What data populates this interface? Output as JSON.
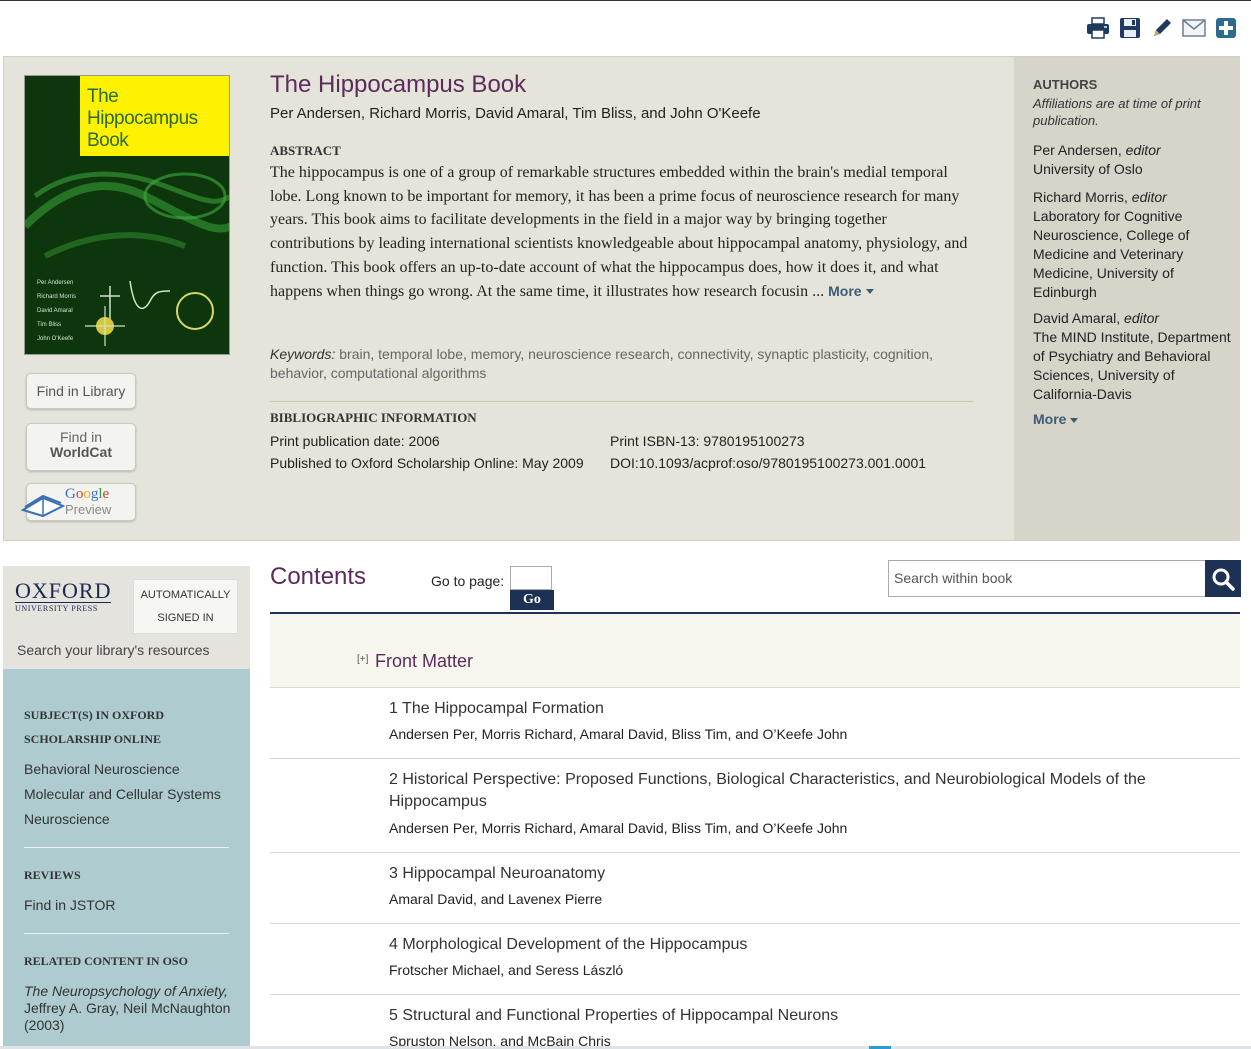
{
  "toolbar": {
    "icons": [
      "print-icon",
      "save-icon",
      "pencil-icon",
      "email-icon",
      "plus-icon"
    ]
  },
  "cover": {
    "title_lines": [
      "The",
      "Hippocampus",
      "Book"
    ],
    "names": [
      "Per Andersen",
      "Richard Morris",
      "David Amaral",
      "Tim Bliss",
      "John O'Keefe"
    ]
  },
  "sidebar_buttons": {
    "library": "Find in Library",
    "worldcat_top": "Find in",
    "worldcat_bottom": "WorldCat",
    "google_top": "Google",
    "google_bottom": "Preview"
  },
  "book": {
    "title": "The Hippocampus Book",
    "authors": "Per Andersen, Richard Morris, David Amaral, Tim Bliss, and John O'Keefe",
    "abstract_head": "ABSTRACT",
    "abstract": "The hippocampus is one of a group of remarkable structures embedded within the brain's medial temporal lobe. Long known to be important for memory, it has been a prime focus of neuroscience research for many years. This book aims to facilitate developments in the field in a major way by bringing together contributions by leading international scientists knowledgeable about hippocampal anatomy, physiology, and function. This book offers an up-to-date account of what the hippocampus does, how it does it, and what happens when things go wrong. At the same time, it illustrates how research focusin ...",
    "more": "More",
    "keywords_label": "Keywords:",
    "keywords": [
      "brain",
      "temporal lobe",
      "memory",
      "neuroscience research",
      "connectivity",
      "synaptic plasticity",
      "cognition",
      "behavior",
      "computational algorithms"
    ],
    "biblio_head": "BIBLIOGRAPHIC INFORMATION",
    "print_date": "Print publication date: 2006",
    "online_date": "Published to Oxford Scholarship Online: May 2009",
    "isbn": "Print ISBN-13: 9780195100273",
    "doi": "DOI:10.1093/acprof:oso/9780195100273.001.0001"
  },
  "authors_panel": {
    "head": "AUTHORS",
    "note": "Affiliations are at time of print publication.",
    "entries": [
      {
        "name": "Per Andersen,",
        "role": "editor",
        "affil": "University of Oslo"
      },
      {
        "name": "Richard Morris,",
        "role": "editor",
        "affil": "Laboratory for Cognitive Neuroscience, College of Medicine and Veterinary Medicine, University of Edinburgh"
      },
      {
        "name": "David Amaral,",
        "role": "editor",
        "affil": "The MIND Institute, Department of Psychiatry and Behavioral Sciences, University of California-Davis"
      }
    ],
    "more": "More"
  },
  "library": {
    "logo_top": "OXFORD",
    "logo_bottom": "UNIVERSITY PRESS",
    "signed_line1": "AUTOMATICALLY",
    "signed_line2": "SIGNED IN",
    "search_text": "Search your library's resources"
  },
  "sidebar": {
    "subjects_head_1": "SUBJECT(S) IN OXFORD",
    "subjects_head_2": "SCHOLARSHIP ONLINE",
    "subjects": [
      "Behavioral Neuroscience",
      "Molecular and Cellular Systems",
      "Neuroscience"
    ],
    "reviews_head": "REVIEWS",
    "reviews_link": "Find in JSTOR",
    "related_head": "RELATED CONTENT IN OSO",
    "related_title": "The Neuropsychology of Anxiety,",
    "related_authors": "Jeffrey A. Gray, Neil McNaughton",
    "related_year": "(2003)"
  },
  "contents": {
    "title": "Contents",
    "goto_label": "Go to page:",
    "goto_button": "Go",
    "search_placeholder": "Search within book",
    "front_matter_toggle": "[+]",
    "front_matter": "Front Matter",
    "chapters": [
      {
        "title": "1 The Hippocampal Formation",
        "authors": "Andersen Per, Morris Richard, Amaral David, Bliss Tim, and O’Keefe John"
      },
      {
        "title": "2 Historical Perspective: Proposed Functions, Biological Characteristics, and Neurobiological Models of the Hippocampus",
        "authors": "Andersen Per, Morris Richard, Amaral David, Bliss Tim, and O’Keefe John"
      },
      {
        "title": "3 Hippocampal Neuroanatomy",
        "authors": "Amaral David, and Lavenex Pierre"
      },
      {
        "title": "4 Morphological Development of the Hippocampus",
        "authors": "Frotscher Michael, and Seress László"
      },
      {
        "title": "5 Structural and Functional Properties of Hippocampal Neurons",
        "authors": "Spruston Nelson, and McBain Chris"
      }
    ]
  }
}
